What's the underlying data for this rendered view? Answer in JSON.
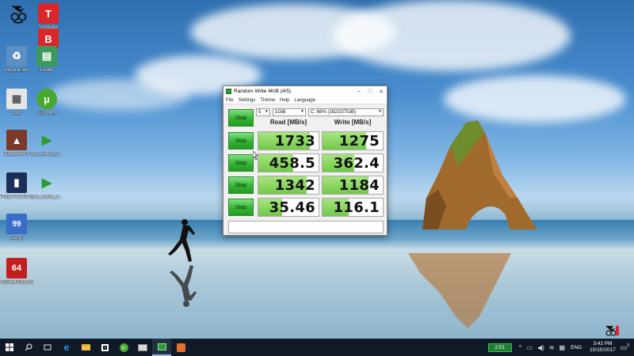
{
  "window": {
    "title": "Random Write 4KiB (4/5)",
    "minimize": "–",
    "maximize": "□",
    "close": "✕",
    "menu": [
      "File",
      "Settings",
      "Theme",
      "Help",
      "Language"
    ]
  },
  "controls": {
    "all_button": "Stop",
    "count": "5",
    "size": "1GiB",
    "drive": "C: 68% (162/237GiB)"
  },
  "headers": {
    "read": "Read [MB/s]",
    "write": "Write [MB/s]"
  },
  "results": [
    {
      "button": "Stop",
      "read": "1733",
      "write": "1275",
      "read_fill_pct": 85,
      "write_fill_pct": 72
    },
    {
      "button": "Stop",
      "read": "458.5",
      "write": "362.4",
      "read_fill_pct": 58,
      "write_fill_pct": 52
    },
    {
      "button": "Stop",
      "read": "1342",
      "write": "1184",
      "read_fill_pct": 80,
      "write_fill_pct": 76
    },
    {
      "button": "Stop",
      "read": "35.46",
      "write": "116.1",
      "read_fill_pct": 40,
      "write_fill_pct": 44
    }
  ],
  "desktop_icons": [
    {
      "label": "",
      "icon": "channel-logo-icon",
      "text": "",
      "color": "#ffffff"
    },
    {
      "label": "Vorbildbk",
      "icon": "tb-logo-icon",
      "text": "T",
      "color": "#d8262b"
    },
    {
      "label": "Recycle Bin",
      "icon": "recycle-bin-icon",
      "text": "♻",
      "color": "#5c8fc4"
    },
    {
      "label": "Folder",
      "icon": "folder-icon",
      "text": "▤",
      "color": "#3b9a5a"
    },
    {
      "label": "Doc",
      "icon": "document-icon",
      "text": "▦",
      "color": "#e6e6e6"
    },
    {
      "label": "µTorrent",
      "icon": "utorrent-icon",
      "text": "µ",
      "color": "#46a82f"
    },
    {
      "label": "Battlefield 1",
      "icon": "battlefield-icon",
      "text": "▲",
      "color": "#7a3a2a"
    },
    {
      "label": "bus_video_2...",
      "icon": "webm-icon",
      "text": "▶",
      "color": "#2e9b2e"
    },
    {
      "label": "Project CARS 2 Deluxe E...",
      "icon": "project-cars-icon",
      "text": "▮",
      "color": "#1b2f5a"
    },
    {
      "label": "bus_video_2...",
      "icon": "webm-icon",
      "text": "▶",
      "color": "#2e9b2e"
    },
    {
      "label": "Jump",
      "icon": "app-icon",
      "text": "99",
      "color": "#3a6dc7"
    },
    {
      "label": "AIDA64 Extreme",
      "icon": "aida64-icon",
      "text": "64",
      "color": "#c21f1f"
    }
  ],
  "taskbar": {
    "battery": "2:51",
    "language": "ENG",
    "time": "3:42 PM",
    "date": "10/10/2017",
    "notifications": "3"
  }
}
